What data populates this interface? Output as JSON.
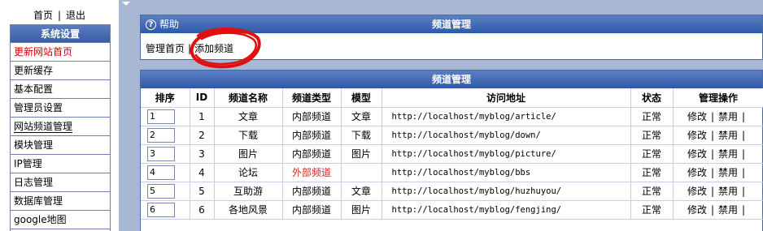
{
  "sidebar": {
    "home_link": "首页",
    "logout_link": "退出",
    "link_separator": "|",
    "menu_title": "系统设置",
    "items": [
      {
        "label": "更新网站首页"
      },
      {
        "label": "更新缓存"
      },
      {
        "label": "基本配置"
      },
      {
        "label": "管理员设置"
      },
      {
        "label": "网站频道管理"
      },
      {
        "label": "模块管理"
      },
      {
        "label": "IP管理"
      },
      {
        "label": "日志管理"
      },
      {
        "label": "数据库管理"
      },
      {
        "label": "google地图"
      }
    ]
  },
  "top_panel": {
    "help_label": "帮助",
    "title": "频道管理",
    "breadcrumb_home": "管理首页",
    "breadcrumb_separator": "|",
    "breadcrumb_add": "添加频道",
    "annotation_color": "#e01010"
  },
  "table_panel": {
    "title": "频道管理",
    "headers": {
      "order": "排序",
      "id": "ID",
      "name": "频道名称",
      "type": "频道类型",
      "model": "模型",
      "url": "访问地址",
      "status": "状态",
      "actions": "管理操作"
    },
    "rows": [
      {
        "order": "1",
        "id": "1",
        "name": "文章",
        "type": "内部频道",
        "model": "文章",
        "url": "http://localhost/myblog/article/",
        "status": "正常",
        "edit": "修改",
        "disable": "禁用",
        "sep": "|"
      },
      {
        "order": "2",
        "id": "2",
        "name": "下载",
        "type": "内部频道",
        "model": "下载",
        "url": "http://localhost/myblog/down/",
        "status": "正常",
        "edit": "修改",
        "disable": "禁用",
        "sep": "|"
      },
      {
        "order": "3",
        "id": "3",
        "name": "图片",
        "type": "内部频道",
        "model": "图片",
        "url": "http://localhost/myblog/picture/",
        "status": "正常",
        "edit": "修改",
        "disable": "禁用",
        "sep": "|"
      },
      {
        "order": "4",
        "id": "4",
        "name": "论坛",
        "type": "外部频道",
        "model": "",
        "url": "http://localhost/myblog/bbs",
        "status": "正常",
        "edit": "修改",
        "disable": "禁用",
        "sep": "|"
      },
      {
        "order": "5",
        "id": "5",
        "name": "互助游",
        "type": "内部频道",
        "model": "文章",
        "url": "http://localhost/myblog/huzhuyou/",
        "status": "正常",
        "edit": "修改",
        "disable": "禁用",
        "sep": "|"
      },
      {
        "order": "6",
        "id": "6",
        "name": "各地风景",
        "type": "内部频道",
        "model": "图片",
        "url": "http://localhost/myblog/fengjing/",
        "status": "正常",
        "edit": "修改",
        "disable": "禁用",
        "sep": "|"
      }
    ],
    "external_type_color": "#d0261e",
    "active_menu_color": "#cc0000"
  }
}
